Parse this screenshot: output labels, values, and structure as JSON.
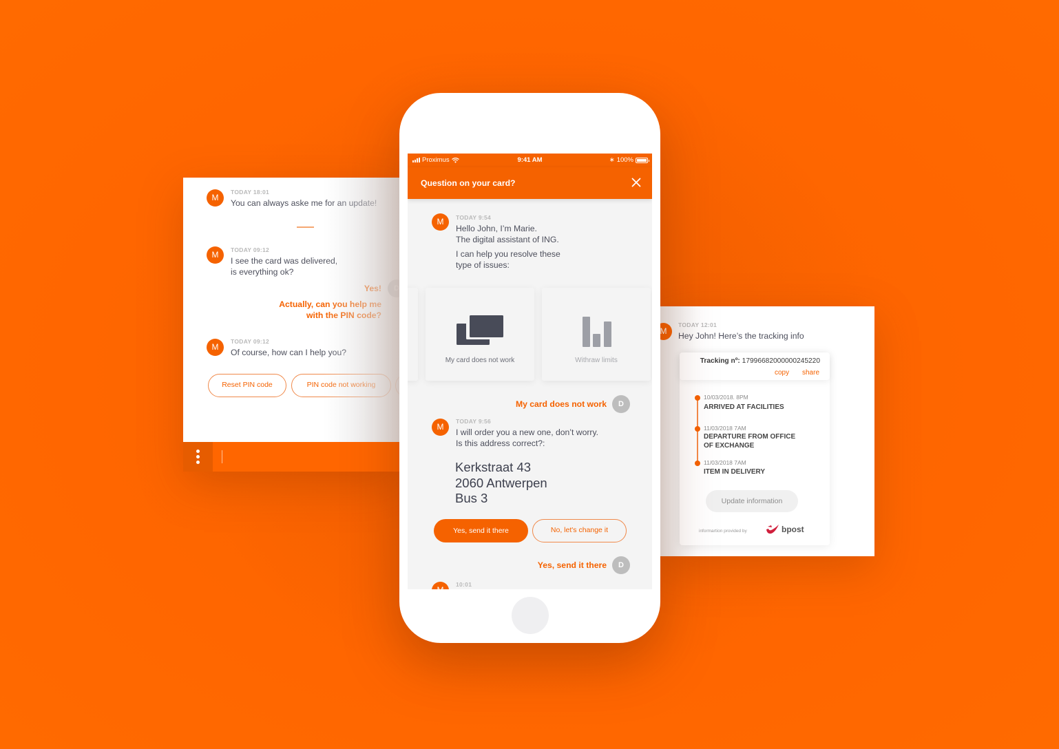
{
  "colors": {
    "brand": "#ff6600",
    "brand_dark": "#f56200",
    "text": "#4d4f5c",
    "muted": "#b9b9b9",
    "user_avatar": "#bdbdbd"
  },
  "left_panel": {
    "messages": [
      {
        "avatar": "M",
        "timestamp": "TODAY 18:01",
        "lines": [
          "You can always aske me for an update!"
        ]
      },
      {
        "avatar": "M",
        "timestamp": "TODAY 09:12",
        "lines": [
          "I see the card was delivered,",
          "is everything ok?"
        ]
      },
      {
        "avatar": "M",
        "timestamp": "TODAY 09:12",
        "lines": [
          "Of course, how can I help you?"
        ]
      }
    ],
    "user_replies": [
      {
        "avatar": "D",
        "text": "Yes!"
      },
      {
        "lines": [
          "Actually, can you help me",
          "with the PIN code?"
        ]
      }
    ],
    "quick_replies": [
      "Reset PIN code",
      "PIN code not working"
    ],
    "menu_icon": "more-vertical-icon"
  },
  "phone": {
    "status_bar": {
      "carrier": "Proximus",
      "time": "9:41 AM",
      "battery": "100%"
    },
    "header": {
      "title": "Question on your card?",
      "close_icon": "close-icon"
    },
    "messages": [
      {
        "avatar": "M",
        "timestamp": "TODAY 9:54",
        "lines": [
          "Hello John, I’m Marie.",
          "The digital assistant of ING."
        ],
        "lines2": [
          "I can help you resolve these",
          "type of issues:"
        ]
      },
      {
        "avatar": "M",
        "timestamp": "TODAY 9:56",
        "lines": [
          "I will order you a new one, don’t worry.",
          "Is this address correct?:"
        ]
      },
      {
        "avatar": "M",
        "timestamp": "10:01"
      }
    ],
    "options": [
      {
        "label": "My card does not work",
        "icon": "cards-icon"
      },
      {
        "label": "Withraw limits",
        "icon": "bar-chart-icon"
      }
    ],
    "user_replies": [
      {
        "avatar": "D",
        "text": "My card does not work"
      },
      {
        "avatar": "D",
        "text": "Yes, send it there"
      }
    ],
    "address": [
      "Kerkstraat 43",
      "2060 Antwerpen",
      "Bus 3"
    ],
    "buttons": {
      "confirm": "Yes, send it there",
      "change": "No, let's change it"
    }
  },
  "right_panel": {
    "message": {
      "avatar": "M",
      "timestamp": "TODAY 12:01",
      "text": "Hey John! Here’s the tracking info"
    },
    "tracking": {
      "label": "Tracking nº:",
      "number": "17996682000000245220",
      "copy": "copy",
      "share": "share"
    },
    "timeline": [
      {
        "date": "10/03/2018. 8PM",
        "status": [
          "ARRIVED AT FACILITIES"
        ]
      },
      {
        "date": "11/03/2018  7AM",
        "status": [
          "DEPARTURE FROM OFFICE",
          "OF EXCHANGE"
        ]
      },
      {
        "date": "11/03/2018  7AM",
        "status": [
          "ITEM IN DELIVERY"
        ]
      }
    ],
    "update_button": "Update information",
    "provided_by": "informartion provided by",
    "provider": "bpost"
  }
}
